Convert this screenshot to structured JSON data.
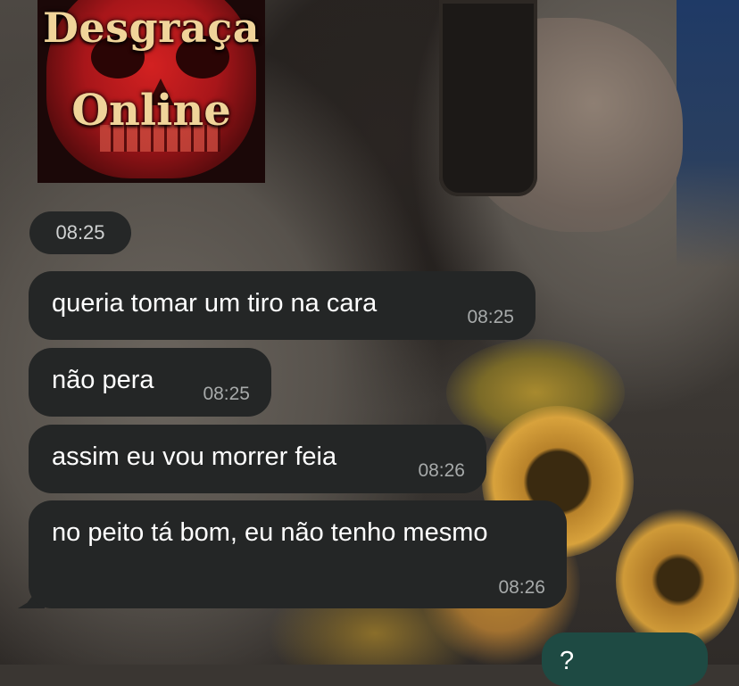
{
  "image_message": {
    "line1": "Desgraça",
    "line2": "Online",
    "time": "08:25"
  },
  "messages": [
    {
      "text": "queria tomar um tiro na cara",
      "time": "08:25"
    },
    {
      "text": "não pera",
      "time": "08:25"
    },
    {
      "text": "assim eu vou morrer feia",
      "time": "08:26"
    },
    {
      "text": "no peito tá bom, eu não tenho mesmo",
      "time": "08:26"
    }
  ],
  "outgoing": {
    "text": "?"
  }
}
